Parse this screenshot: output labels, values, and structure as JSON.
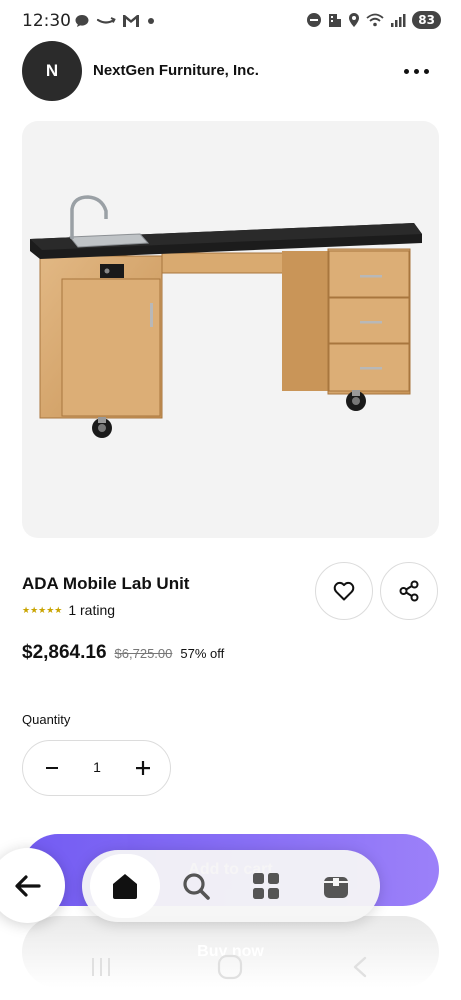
{
  "status_bar": {
    "time": "12:30",
    "battery": "83",
    "left_icons": [
      "chat-icon",
      "amazon-icon",
      "gmail-icon",
      "dot-icon"
    ],
    "right_icons": [
      "do-not-disturb-icon",
      "building-icon",
      "location-icon",
      "wifi-icon",
      "signal-icon"
    ]
  },
  "seller": {
    "avatar_letter": "N",
    "name": "NextGen Furniture, Inc."
  },
  "product": {
    "title": "ADA Mobile Lab Unit",
    "stars": "★★★★★",
    "rating_text": "1 rating",
    "price": "$2,864.16",
    "original_price": "$6,725.00",
    "discount": "57% off"
  },
  "quantity": {
    "label": "Quantity",
    "value": "1"
  },
  "actions": {
    "add_to_cart": "Add to cart",
    "buy_now": "Buy now"
  },
  "bottom_nav": {
    "items": [
      "home-icon",
      "search-icon",
      "categories-icon",
      "orders-icon"
    ],
    "active": "home-icon"
  },
  "colors": {
    "accent": "#6a4ff4",
    "star": "#c9a400",
    "avatar_bg": "#2b2b2b"
  }
}
